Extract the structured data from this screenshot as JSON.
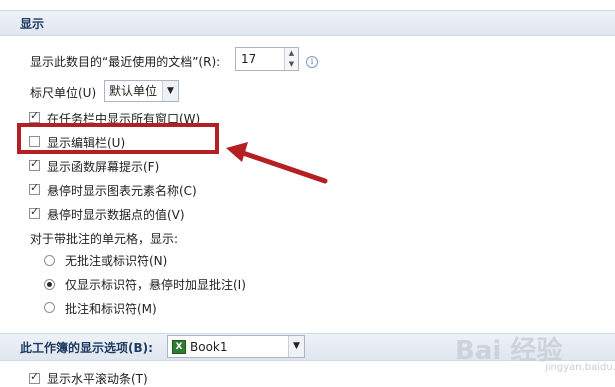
{
  "section1": {
    "title": "显示"
  },
  "recent_docs": {
    "label": "显示此数目的“最近使用的文档”(R):",
    "value": "17"
  },
  "ruler": {
    "label": "标尺单位(U)",
    "value": "默认单位"
  },
  "checkboxes": [
    {
      "label": "在任务栏中显示所有窗口(W)",
      "checked": true
    },
    {
      "label": "显示编辑栏(U)",
      "checked": false
    },
    {
      "label": "显示函数屏幕提示(F)",
      "checked": true
    },
    {
      "label": "悬停时显示图表元素名称(C)",
      "checked": true
    },
    {
      "label": "悬停时显示数据点的值(V)",
      "checked": true
    }
  ],
  "comments": {
    "label": "对于带批注的单元格，显示:",
    "options": [
      {
        "label": "无批注或标识符(N)",
        "selected": false
      },
      {
        "label": "仅显示标识符，悬停时加显批注(I)",
        "selected": true
      },
      {
        "label": "批注和标识符(M)",
        "selected": false
      }
    ]
  },
  "section2": {
    "title": "此工作簿的显示选项(B):",
    "workbook": "Book1"
  },
  "bottom_checkbox": {
    "label": "显示水平滚动条(T)",
    "checked": true
  },
  "watermark": {
    "text": "Bai 经验",
    "sub": "jingyan.baidu.com"
  },
  "colors": {
    "accent_red": "#b41f24",
    "header_text": "#1f3a63"
  }
}
